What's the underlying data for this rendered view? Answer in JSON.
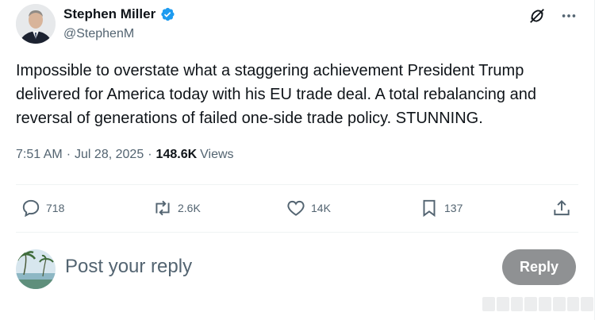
{
  "author": {
    "name": "Stephen Miller",
    "handle": "@StephenM"
  },
  "tweet": {
    "text": "Impossible to overstate what a staggering achievement President Trump delivered for America today with his EU trade deal. A total rebalancing and reversal of generations of failed one-side trade policy. STUNNING.",
    "time": "7:51 AM",
    "date": "Jul 28, 2025",
    "separator": "·",
    "views_count": "148.6K",
    "views_label": "Views"
  },
  "actions": {
    "replies": "718",
    "reposts": "2.6K",
    "likes": "14K",
    "bookmarks": "137"
  },
  "reply": {
    "placeholder": "Post your reply",
    "button_label": "Reply"
  },
  "colors": {
    "text": "#0f1419",
    "secondary": "#536471",
    "verified": "#1d9bf0",
    "reply_button": "#8f9193",
    "divider": "#eff3f4"
  },
  "icons": [
    "verified-badge-icon",
    "grok-icon",
    "more-icon",
    "reply-icon",
    "repost-icon",
    "like-icon",
    "bookmark-icon",
    "share-icon"
  ]
}
